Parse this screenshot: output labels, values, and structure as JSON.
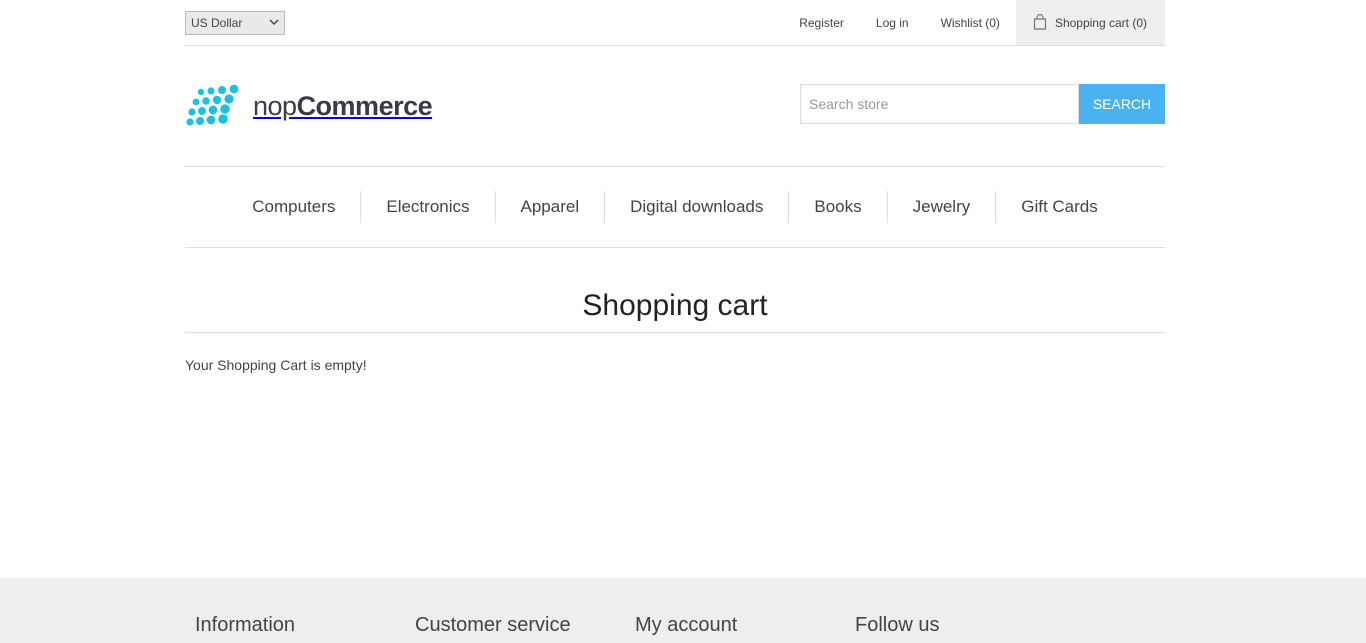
{
  "header": {
    "currency": "US Dollar",
    "links": {
      "register": "Register",
      "login": "Log in",
      "wishlist": "Wishlist (0)",
      "cart": "Shopping cart (0)"
    }
  },
  "logo": {
    "part1": "nop",
    "part2": "Commerce"
  },
  "search": {
    "placeholder": "Search store",
    "button": "SEARCH"
  },
  "menu": [
    "Computers",
    "Electronics",
    "Apparel",
    "Digital downloads",
    "Books",
    "Jewelry",
    "Gift Cards"
  ],
  "page": {
    "title": "Shopping cart",
    "message": "Your Shopping Cart is empty!"
  },
  "footer": {
    "columns": [
      "Information",
      "Customer service",
      "My account",
      "Follow us"
    ]
  },
  "colors": {
    "accent": "#4ab2f1",
    "logo_dots": "#1ec0e0",
    "footer_bg": "#eeeeee"
  }
}
